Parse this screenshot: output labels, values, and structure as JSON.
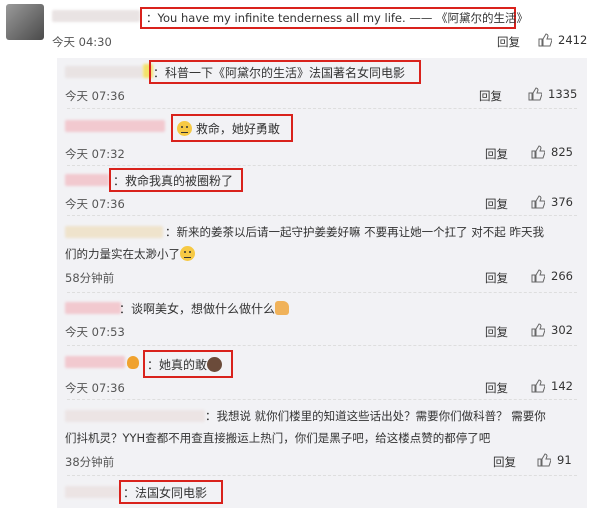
{
  "top_comment": {
    "text": "：You have my infinite tenderness all my life. —— 《阿黛尔的生活》",
    "time": "今天 04:30",
    "reply_label": "回复",
    "likes": "2412"
  },
  "replies": [
    {
      "text": "：科普一下《阿黛尔的生活》法国著名女同电影",
      "time": "今天 07:36",
      "reply_label": "回复",
      "likes": "1335"
    },
    {
      "text": "救命，她好勇敢",
      "time": "今天 07:32",
      "reply_label": "回复",
      "likes": "825"
    },
    {
      "text": "：救命我真的被圈粉了",
      "time": "今天 07:36",
      "reply_label": "回复",
      "likes": "376"
    },
    {
      "text_line1": "：新来的姜茶以后请一起守护姜姜好嘛 不要再让她一个扛了  对不起 昨天我",
      "text_line2": "们的力量实在太渺小了",
      "time": "58分钟前",
      "reply_label": "回复",
      "likes": "266"
    },
    {
      "text": "：谈啊美女，想做什么做什么",
      "time": "今天 07:53",
      "reply_label": "回复",
      "likes": "302"
    },
    {
      "text": "：她真的敢",
      "time": "今天 07:36",
      "reply_label": "回复",
      "likes": "142"
    },
    {
      "text_line1": "：我想说 就你们楼里的知道这些话出处？需要你们做科普？ 需要你",
      "text_line2": "们抖机灵？YYH查都不用查直接搬运上热门，你们是黑子吧，给这楼点赞的都停了吧",
      "time": "38分钟前",
      "reply_label": "回复",
      "likes": "91"
    },
    {
      "text": "：法国女同电影"
    }
  ]
}
